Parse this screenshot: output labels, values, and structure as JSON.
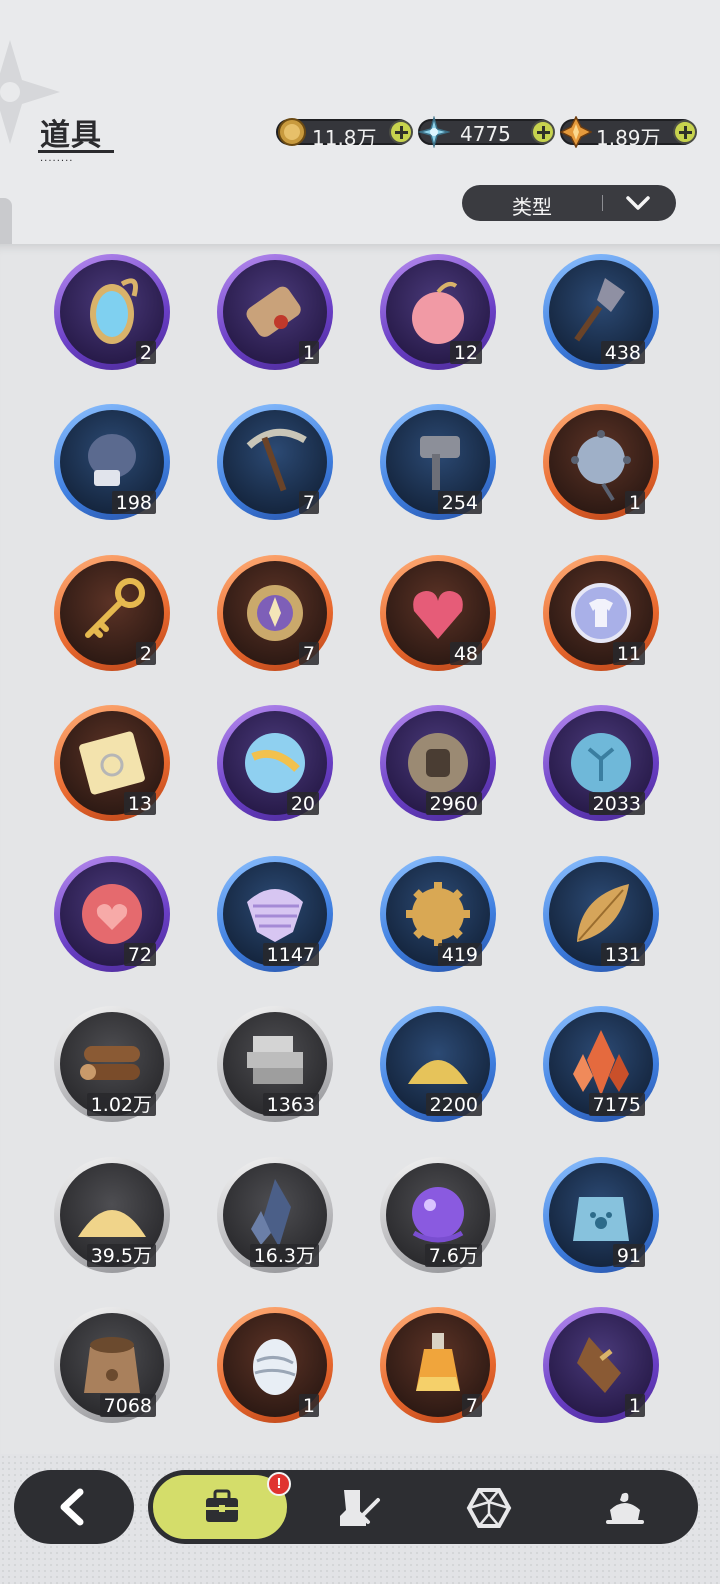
{
  "header": {
    "title": "道具"
  },
  "currencies": [
    {
      "name": "gold-coin-icon",
      "value": "11.8万"
    },
    {
      "name": "crystal-icon",
      "value": "4775"
    },
    {
      "name": "star-gem-icon",
      "value": "1.89万"
    }
  ],
  "filter": {
    "label": "类型"
  },
  "items": [
    {
      "icon": "mirror-icon",
      "rarity": "purple",
      "count": "2"
    },
    {
      "icon": "scroll-icon",
      "rarity": "purple",
      "count": "1"
    },
    {
      "icon": "apple-icon",
      "rarity": "purple",
      "count": "12"
    },
    {
      "icon": "shovel-icon",
      "rarity": "blue",
      "count": "438"
    },
    {
      "icon": "boxing-glove-icon",
      "rarity": "blue",
      "count": "198"
    },
    {
      "icon": "pickaxe-icon",
      "rarity": "blue",
      "count": "7"
    },
    {
      "icon": "hammer-icon",
      "rarity": "blue",
      "count": "254"
    },
    {
      "icon": "spiked-ball-icon",
      "rarity": "orange",
      "count": "1"
    },
    {
      "icon": "key-icon",
      "rarity": "orange",
      "count": "2"
    },
    {
      "icon": "emblem-icon",
      "rarity": "orange",
      "count": "7"
    },
    {
      "icon": "gem-heart-icon",
      "rarity": "orange",
      "count": "48"
    },
    {
      "icon": "shirt-token-icon",
      "rarity": "orange",
      "count": "11"
    },
    {
      "icon": "ticket-icon",
      "rarity": "orange",
      "count": "13"
    },
    {
      "icon": "globe-orb-icon",
      "rarity": "purple",
      "count": "20"
    },
    {
      "icon": "fist-coin-icon",
      "rarity": "purple",
      "count": "2960"
    },
    {
      "icon": "rune-coin-icon",
      "rarity": "purple",
      "count": "2033"
    },
    {
      "icon": "heart-coin-icon",
      "rarity": "purple",
      "count": "72"
    },
    {
      "icon": "scale-shield-icon",
      "rarity": "blue",
      "count": "1147"
    },
    {
      "icon": "gear-icon",
      "rarity": "blue",
      "count": "419"
    },
    {
      "icon": "leaf-icon",
      "rarity": "blue",
      "count": "131"
    },
    {
      "icon": "wood-logs-icon",
      "rarity": "grey",
      "count": "1.02万"
    },
    {
      "icon": "stone-bricks-icon",
      "rarity": "grey",
      "count": "1363"
    },
    {
      "icon": "gold-pile-icon",
      "rarity": "blue",
      "count": "2200"
    },
    {
      "icon": "red-crystal-icon",
      "rarity": "blue",
      "count": "7175"
    },
    {
      "icon": "sand-pile-icon",
      "rarity": "grey",
      "count": "39.5万"
    },
    {
      "icon": "dark-crystal-icon",
      "rarity": "grey",
      "count": "16.3万"
    },
    {
      "icon": "purple-orb-icon",
      "rarity": "grey",
      "count": "7.6万"
    },
    {
      "icon": "paw-food-bag-icon",
      "rarity": "blue",
      "count": "91"
    },
    {
      "icon": "food-sack-icon",
      "rarity": "grey",
      "count": "7068"
    },
    {
      "icon": "egg-icon",
      "rarity": "orange",
      "count": "1"
    },
    {
      "icon": "potion-bottle-icon",
      "rarity": "orange",
      "count": "7"
    },
    {
      "icon": "broom-icon",
      "rarity": "purple",
      "count": "1"
    }
  ],
  "nav": {
    "tabs": [
      {
        "name": "bag-icon",
        "active": true
      },
      {
        "name": "equipment-icon",
        "active": false
      },
      {
        "name": "gem-icon",
        "active": false
      },
      {
        "name": "dessert-icon",
        "active": false
      }
    ],
    "alert": "!"
  }
}
